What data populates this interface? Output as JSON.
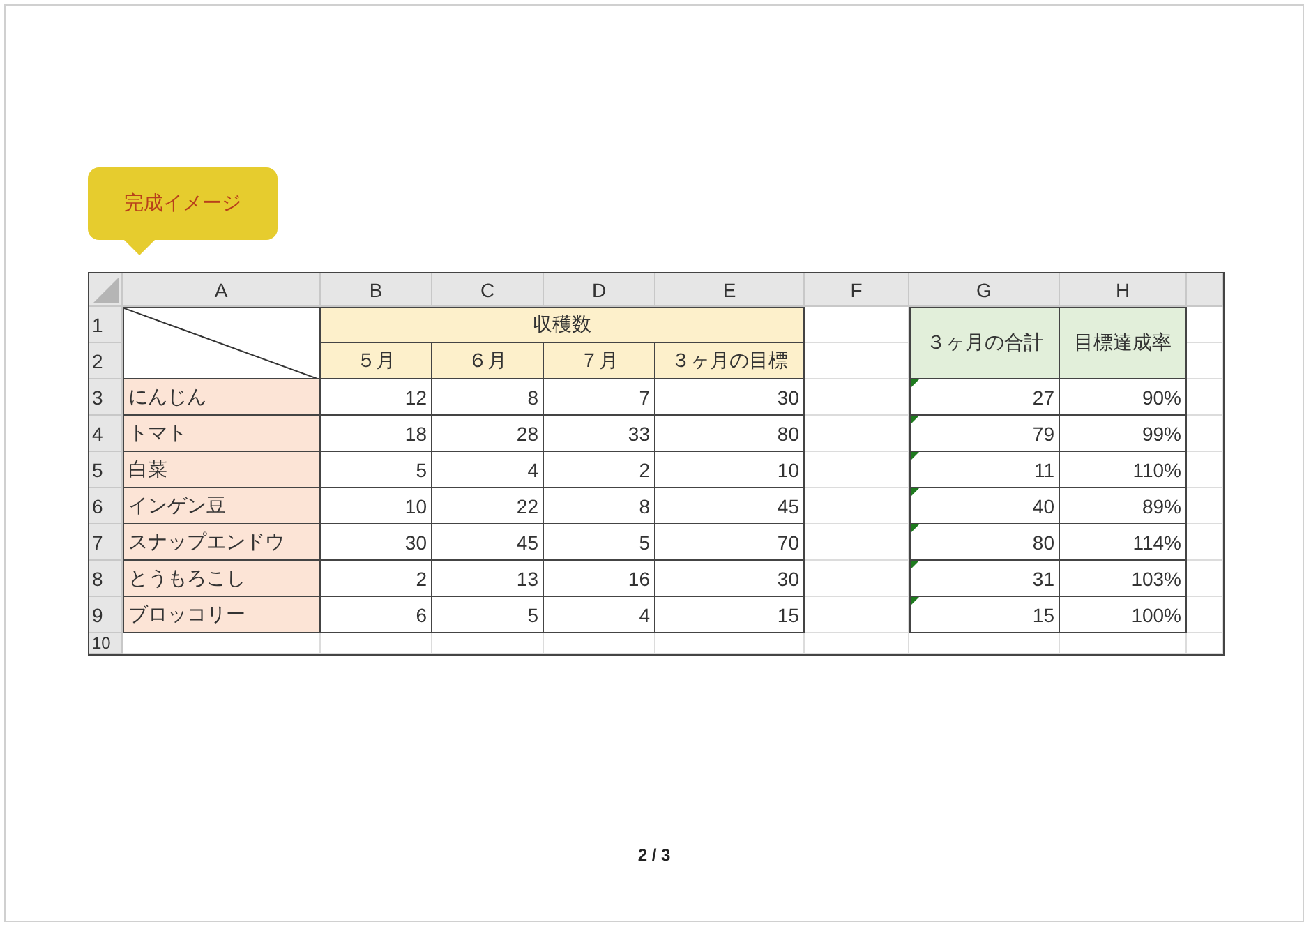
{
  "callout": {
    "label": "完成イメージ"
  },
  "sheet": {
    "columns": [
      "A",
      "B",
      "C",
      "D",
      "E",
      "F",
      "G",
      "H"
    ],
    "row_numbers": [
      "1",
      "2",
      "3",
      "4",
      "5",
      "6",
      "7",
      "8",
      "9",
      "10"
    ],
    "group_header": "収穫数",
    "month_headers": [
      "５月",
      "６月",
      "７月"
    ],
    "target_header": "３ヶ月の目標",
    "total_header": "３ヶ月の合計",
    "rate_header": "目標達成率",
    "rows": [
      {
        "name": "にんじん",
        "values": [
          "12",
          "8",
          "7"
        ],
        "target": "30",
        "total": "27",
        "rate": "90%",
        "warning": true
      },
      {
        "name": "トマト",
        "values": [
          "18",
          "28",
          "33"
        ],
        "target": "80",
        "total": "79",
        "rate": "99%",
        "warning": true
      },
      {
        "name": "白菜",
        "values": [
          "5",
          "4",
          "2"
        ],
        "target": "10",
        "total": "11",
        "rate": "110%",
        "warning": true
      },
      {
        "name": "インゲン豆",
        "values": [
          "10",
          "22",
          "8"
        ],
        "target": "45",
        "total": "40",
        "rate": "89%",
        "warning": true
      },
      {
        "name": "スナップエンドウ",
        "values": [
          "30",
          "45",
          "5"
        ],
        "target": "70",
        "total": "80",
        "rate": "114%",
        "warning": true
      },
      {
        "name": "とうもろこし",
        "values": [
          "2",
          "13",
          "16"
        ],
        "target": "30",
        "total": "31",
        "rate": "103%",
        "warning": true
      },
      {
        "name": "ブロッコリー",
        "values": [
          "6",
          "5",
          "4"
        ],
        "target": "15",
        "total": "15",
        "rate": "100%",
        "warning": true
      }
    ]
  },
  "page_indicator": "2 / 3"
}
